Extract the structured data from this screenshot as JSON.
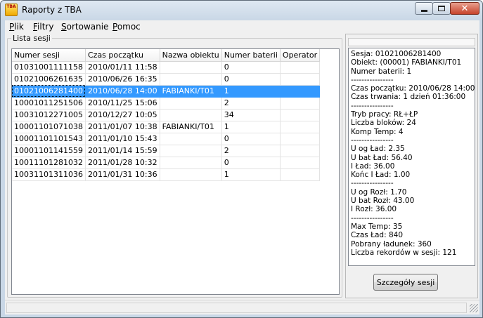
{
  "window": {
    "title": "Raporty z TBA",
    "icon_text": "TBA"
  },
  "menu": [
    "Plik",
    "Filtry",
    "Sortowanie",
    "Pomoc"
  ],
  "session_list": {
    "caption": "Lista sesji",
    "columns": [
      "Numer sesji",
      "Czas początku",
      "Nazwa obiektu",
      "Numer baterii",
      "Operator"
    ],
    "selected_index": 2,
    "rows": [
      [
        "01031001111158",
        "2010/01/11 11:58",
        "",
        "0",
        ""
      ],
      [
        "01021006261635",
        "2010/06/26 16:35",
        "",
        "0",
        ""
      ],
      [
        "01021006281400",
        "2010/06/28 14:00",
        "FABIANKI/T01",
        "1",
        ""
      ],
      [
        "10001011251506",
        "2010/11/25 15:06",
        "",
        "2",
        ""
      ],
      [
        "10031012271005",
        "2010/12/27 10:05",
        "",
        "34",
        ""
      ],
      [
        "10001101071038",
        "2011/01/07 10:38",
        "FABIANKI/T01",
        "1",
        ""
      ],
      [
        "10001101101543",
        "2011/01/10 15:43",
        "",
        "0",
        ""
      ],
      [
        "10001101141559",
        "2011/01/14 15:59",
        "",
        "2",
        ""
      ],
      [
        "10011101281032",
        "2011/01/28 10:32",
        "",
        "0",
        ""
      ],
      [
        "10031101311036",
        "2011/01/31 10:36",
        "",
        "1",
        ""
      ]
    ]
  },
  "details": {
    "lines": [
      "Sesja: 01021006281400",
      "Obiekt: (00001) FABIANKI/T01",
      "Numer baterii: 1",
      "----------------",
      "Czas początku: 2010/06/28 14:00",
      "Czas trwania: 1 dzień 01:36:00",
      "----------------",
      "Tryb pracy: RŁ+ŁP",
      "Liczba bloków: 24",
      "Komp Temp: 4",
      "----------------",
      "U og Ład: 2.35",
      "U bat Ład: 56.40",
      "I Ład: 36.00",
      "Końc I Ład: 1.00",
      "----------------",
      "U og Rozł: 1.70",
      "U bat Rozł: 43.00",
      "I Rozł: 36.00",
      "----------------",
      "Max Temp: 35",
      "Czas Ład: 840",
      "Pobrany ładunek: 360",
      "Liczba rekordów w sesji: 121"
    ],
    "button_label": "Szczegóły sesji"
  },
  "colors": {
    "selection": "#3399ff",
    "window_frame": "#c9d7e6",
    "close_button": "#c7432b"
  }
}
